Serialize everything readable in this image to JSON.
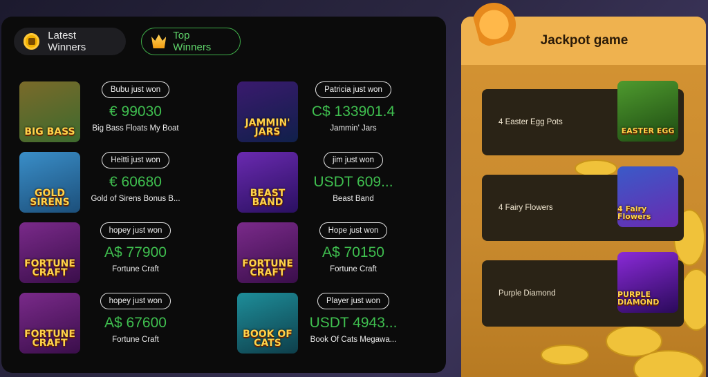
{
  "tabs": {
    "latest_label": "Latest Winners",
    "top_label": "Top Winners",
    "latest_icon": "coin-icon",
    "top_icon": "crown-icon"
  },
  "winners": [
    {
      "player_text": "Bubu just won",
      "amount": "€ 99030",
      "game": "Big Bass Floats My Boat",
      "thumb_text": "BIG BASS",
      "thumb_colors": [
        "#7a6a2a",
        "#3d6a2e"
      ]
    },
    {
      "player_text": "Patricia just won",
      "amount": "C$ 133901.4",
      "game": "Jammin' Jars",
      "thumb_text": "JAMMIN' JARS",
      "thumb_colors": [
        "#3a1a6e",
        "#10204a"
      ]
    },
    {
      "player_text": "Heitti just won",
      "amount": "€ 60680",
      "game": "Gold of Sirens Bonus B...",
      "thumb_text": "GOLD SIRENS",
      "thumb_colors": [
        "#3a8ec8",
        "#1c4f7a"
      ]
    },
    {
      "player_text": "jim just won",
      "amount": "USDT 609...",
      "game": "Beast Band",
      "thumb_text": "BEAST BAND",
      "thumb_colors": [
        "#6a2ab0",
        "#2a1060"
      ]
    },
    {
      "player_text": "hopey just won",
      "amount": "A$ 77900",
      "game": "Fortune Craft",
      "thumb_text": "FORTUNE CRAFT",
      "thumb_colors": [
        "#7a2a8a",
        "#3a0e4a"
      ]
    },
    {
      "player_text": "Hope just won",
      "amount": "A$ 70150",
      "game": "Fortune Craft",
      "thumb_text": "FORTUNE CRAFT",
      "thumb_colors": [
        "#7a2a8a",
        "#3a0e4a"
      ]
    },
    {
      "player_text": "hopey just won",
      "amount": "A$ 67600",
      "game": "Fortune Craft",
      "thumb_text": "FORTUNE CRAFT",
      "thumb_colors": [
        "#7a2a8a",
        "#3a0e4a"
      ]
    },
    {
      "player_text": "Player just won",
      "amount": "USDT 4943...",
      "game": "Book Of Cats Megawa...",
      "thumb_text": "BOOK OF CATS",
      "thumb_colors": [
        "#1e8e9a",
        "#0e3e4a"
      ]
    }
  ],
  "jackpot": {
    "title": "Jackpot game",
    "header_icon": "fortune-cookie-icon",
    "games": [
      {
        "name": "4 Easter Egg Pots",
        "thumb_text": "EASTER EGG",
        "thumb_colors": [
          "#4e9a2e",
          "#1e4a12"
        ]
      },
      {
        "name": "4 Fairy Flowers",
        "thumb_text": "4 Fairy Flowers",
        "thumb_colors": [
          "#3a5ac8",
          "#6a2ab0"
        ]
      },
      {
        "name": "Purple Diamond",
        "thumb_text": "PURPLE DIAMOND",
        "thumb_colors": [
          "#8a2ad8",
          "#2a0a5a"
        ]
      }
    ]
  },
  "colors": {
    "accent_green": "#3fbf4f",
    "jackpot_bg": "#d59433",
    "panel_bg": "#0b0b0b"
  }
}
